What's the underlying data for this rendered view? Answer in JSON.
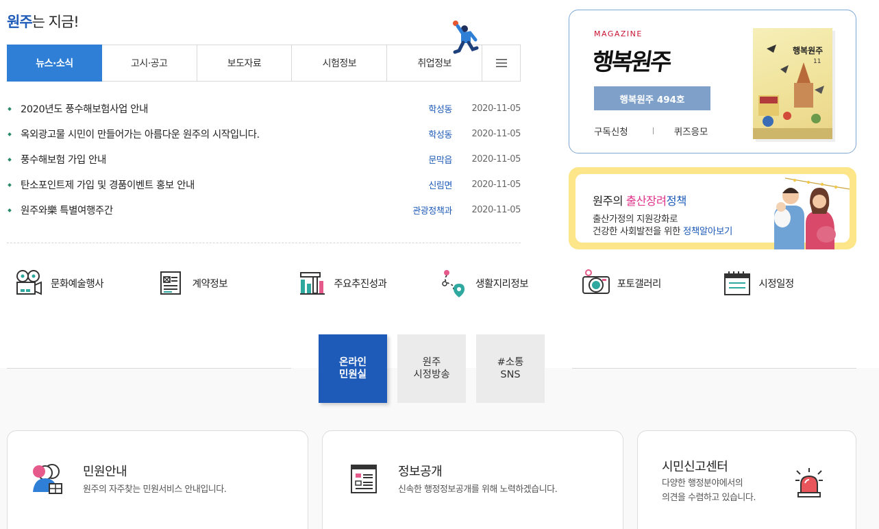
{
  "section": {
    "title_highlight": "원주",
    "title_rest": "는 지금!"
  },
  "tabs": [
    {
      "label": "뉴스·소식",
      "active": true
    },
    {
      "label": "고시·공고"
    },
    {
      "label": "보도자료"
    },
    {
      "label": "시험정보"
    },
    {
      "label": "취업정보"
    }
  ],
  "news": [
    {
      "title": "2020년도 풍수해보험사업 안내",
      "dept": "학성동",
      "date": "2020-11-05"
    },
    {
      "title": "옥외광고물 시민이 만들어가는 아름다운 원주의 시작입니다.",
      "dept": "학성동",
      "date": "2020-11-05"
    },
    {
      "title": "풍수해보험 가입 안내",
      "dept": "문막읍",
      "date": "2020-11-05"
    },
    {
      "title": "탄소포인트제 가입 및 경품이벤트 홍보 안내",
      "dept": "신림면",
      "date": "2020-11-05"
    },
    {
      "title": "원주와樂 특별여행주간",
      "dept": "관광정책과",
      "date": "2020-11-05"
    }
  ],
  "magazine": {
    "label": "MAGAZINE",
    "logo": "행복원주",
    "issue_button": "행복원주 494호",
    "subscribe": "구독신청",
    "quiz": "퀴즈응모",
    "cover_title": "행복원주",
    "cover_number": "11"
  },
  "birth": {
    "title_prefix": "원주의 ",
    "title_pink": "출산장려",
    "title_blue": "정책",
    "desc_line1": "출산가정의 지원강화로",
    "desc_line2_prefix": "건강한 사회발전을 위한 ",
    "desc_link": "정책알아보기"
  },
  "quick": [
    {
      "label": "문화예술행사",
      "icon": "film-projector-icon"
    },
    {
      "label": "계약정보",
      "icon": "document-icon"
    },
    {
      "label": "주요추진성과",
      "icon": "bar-chart-icon"
    },
    {
      "label": "생활지리정보",
      "icon": "map-pin-icon"
    },
    {
      "label": "포토갤러리",
      "icon": "camera-icon"
    },
    {
      "label": "시정일정",
      "icon": "calendar-icon"
    }
  ],
  "lower_tabs": [
    {
      "line1": "온라인",
      "line2": "민원실",
      "active": true
    },
    {
      "line1": "원주",
      "line2": "시정방송"
    },
    {
      "line1": "#소통",
      "line2": "SNS"
    }
  ],
  "cards": [
    {
      "title": "민원안내",
      "desc": "원주의 자주찾는 민원서비스 안내입니다.",
      "icon": "people-icon"
    },
    {
      "title": "정보공개",
      "desc": "신속한 행정정보공개를 위해 노력하겠습니다.",
      "icon": "info-document-icon"
    },
    {
      "title": "시민신고센터",
      "desc1": "다양한 행정분야에서의",
      "desc2": "의견을 수렴하고 있습니다.",
      "icon": "siren-icon"
    }
  ],
  "colors": {
    "primary": "#2f7fd6",
    "dark_blue": "#1e5bb8",
    "pink": "#e0338a",
    "yellow": "#fde58a"
  }
}
